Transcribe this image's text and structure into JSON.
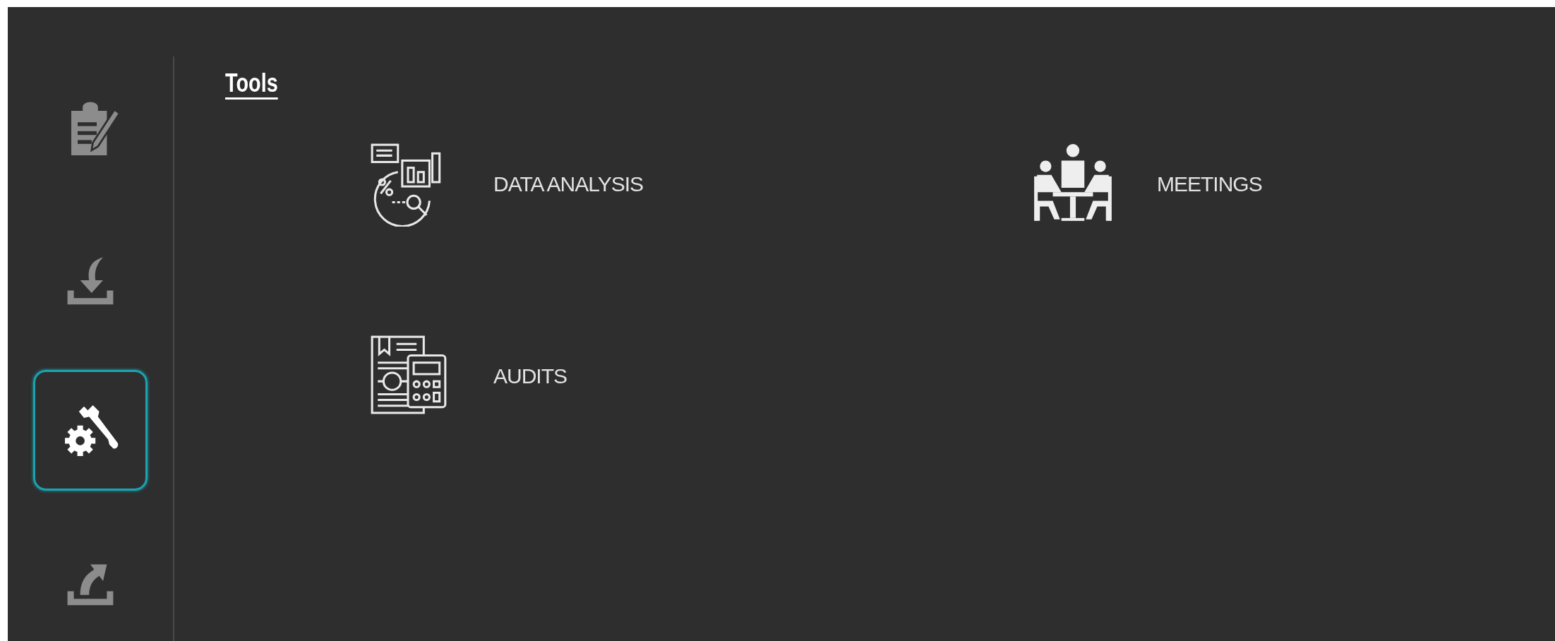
{
  "sidebar": {
    "items": [
      {
        "kind": "clipboard",
        "selected": false
      },
      {
        "kind": "download",
        "selected": false
      },
      {
        "kind": "tools",
        "selected": true
      },
      {
        "kind": "upload",
        "selected": false
      }
    ]
  },
  "page": {
    "title": "Tools"
  },
  "tools": [
    {
      "kind": "data",
      "label": "DATA ANALYSIS"
    },
    {
      "kind": "meeting",
      "label": "MEETINGS"
    },
    {
      "kind": "audit",
      "label": "AUDITS"
    }
  ]
}
